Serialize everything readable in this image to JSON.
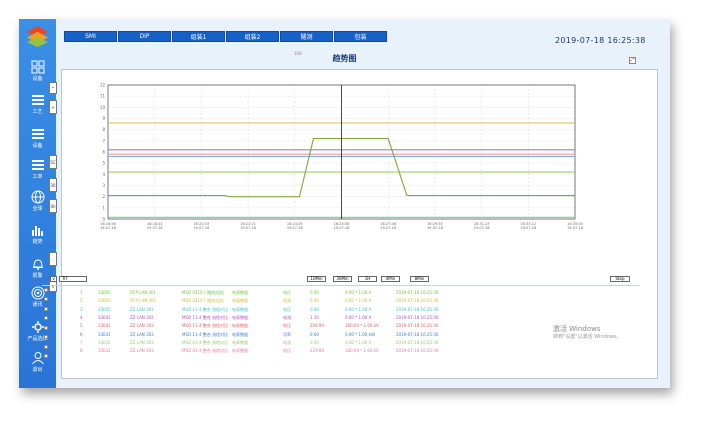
{
  "app": {
    "datetime": "2019-07-18  16:25:38",
    "page_title": "趋势图"
  },
  "tabs": [
    {
      "label": "SMI"
    },
    {
      "label": "DIP"
    },
    {
      "label": "组装1"
    },
    {
      "label": "组装2"
    },
    {
      "label": "隧测"
    },
    {
      "label": "包装"
    }
  ],
  "sidebar": {
    "items": [
      {
        "label": "设备",
        "icon": "grid-icon"
      },
      {
        "label": "工艺",
        "icon": "list-icon"
      },
      {
        "label": "设备",
        "icon": "list-icon"
      },
      {
        "label": "工单",
        "icon": "list-icon"
      },
      {
        "label": "全球",
        "icon": "globe-icon"
      },
      {
        "label": "趋势",
        "icon": "bar-chart-icon"
      },
      {
        "label": "报警",
        "icon": "bell-icon"
      },
      {
        "label": "通讯",
        "icon": "target-icon"
      },
      {
        "label": "产品选择",
        "icon": "gear-icon"
      },
      {
        "label": "退出",
        "icon": "user-icon"
      }
    ]
  },
  "chart_controls": {
    "legend_top": "100",
    "left_buttons": [
      "^",
      "+",
      "5C",
      "30",
      "Sh",
      "-",
      "v"
    ],
    "bottom_left": "v",
    "trend_label": "TrT",
    "zoom_buttons": [
      "10Min",
      "30Min",
      "1H",
      "4Min",
      "8Min"
    ],
    "stop_label": "Stop",
    "expand_label": "⤢"
  },
  "chart_data": {
    "type": "line",
    "y_ticks": [
      "12",
      "11",
      "10",
      "9",
      "8",
      "7",
      "6",
      "5",
      "4",
      "3",
      "2",
      "1",
      "0"
    ],
    "x_labels": [
      [
        "16:16:56",
        "19-07-18"
      ],
      [
        "16:18:44",
        "19-07-18"
      ],
      [
        "16:20:33",
        "19-07-18"
      ],
      [
        "16:22:21",
        "19-07-18"
      ],
      [
        "16:24:09",
        "19-07-18"
      ],
      [
        "16:25:58",
        "19-07-18"
      ],
      [
        "16:27:46",
        "19-07-18"
      ],
      [
        "16:29:35",
        "19-07-18"
      ],
      [
        "16:31:23",
        "19-07-18"
      ],
      [
        "16:33:12",
        "19-07-18"
      ],
      [
        "16:35:00",
        "19-07-18"
      ]
    ],
    "ylim": [
      0,
      12
    ],
    "cursor_x": 5,
    "grid": true,
    "series": [
      {
        "color": "#e3c35a",
        "values": [
          [
            0,
            8.6
          ],
          [
            10,
            8.6
          ]
        ]
      },
      {
        "color": "#9b7fd1",
        "values": [
          [
            0,
            6.2
          ],
          [
            10,
            6.2
          ]
        ]
      },
      {
        "color": "#e89ba0",
        "values": [
          [
            0,
            5.8
          ],
          [
            10,
            5.8
          ]
        ]
      },
      {
        "color": "#7cb4e8",
        "values": [
          [
            0,
            5.6
          ],
          [
            10,
            5.6
          ]
        ]
      },
      {
        "color": "#a3c873",
        "values": [
          [
            0,
            4.2
          ],
          [
            10,
            4.2
          ]
        ]
      },
      {
        "color": "#7ea83c",
        "values": [
          [
            0,
            2.1
          ],
          [
            2.5,
            2.1
          ],
          [
            2.6,
            2.0
          ],
          [
            4.1,
            2.0
          ],
          [
            4.4,
            7.2
          ],
          [
            6.0,
            7.2
          ],
          [
            6.4,
            2.1
          ],
          [
            10,
            2.1
          ]
        ]
      },
      {
        "color": "#6fd97a",
        "values": [
          [
            0,
            0.15
          ],
          [
            10,
            0.15
          ]
        ]
      }
    ]
  },
  "table": {
    "rows": [
      {
        "no": "1",
        "c2": "33E05",
        "c3": "OFP LAN 301",
        "c4": "MSO 0410 门槛电话机",
        "c5": "电表数据",
        "c6": "电压",
        "c7": "0.00",
        "c8": "0.00 * 1.00 A",
        "c9": "2019-07-18 16:25:36",
        "color": "#6fc83e"
      },
      {
        "no": "2",
        "c2": "33E05",
        "c3": "OFP LAN 302",
        "c4": "MSO 0410 门槛电话机",
        "c5": "电表数据",
        "c6": "电流",
        "c7": "0.00",
        "c8": "0.00 * 1.00 A",
        "c9": "2019-07-18 16:25:36",
        "color": "#d6b83a"
      },
      {
        "no": "3",
        "c2": "33E05",
        "c3": "ZZ LAN 301",
        "c4": "MSO 11-4 整合 流程对比",
        "c5": "电表数据",
        "c6": "电压",
        "c7": "0.00",
        "c8": "0.00 * 1.00 A",
        "c9": "2019-07-18 16:25:36",
        "color": "#3ec4c8"
      },
      {
        "no": "4",
        "c2": "33E41",
        "c3": "ZZ LAN 302",
        "c4": "MSO 11-4 整合 流程对比",
        "c5": "电表数据",
        "c6": "电流",
        "c7": "1.10",
        "c8": "0.00 * 1.00 A",
        "c9": "2019-07-18 16:25:36",
        "color": "#b04cc8"
      },
      {
        "no": "5",
        "c2": "33E41",
        "c3": "ZZ LAN 303",
        "c4": "MSO 11-4 整合 流程对比",
        "c5": "电表数据",
        "c6": "电压",
        "c7": "228.90",
        "c8": "180.00 * 1.00 kV",
        "c9": "2019-07-18 16:25:36",
        "color": "#e85c5c"
      },
      {
        "no": "6",
        "c2": "33E41",
        "c3": "ZZ LAN 303",
        "c4": "MSO 11-4 整合 流程对比",
        "c5": "电表数据",
        "c6": "功率",
        "c7": "0.00",
        "c8": "0.00 * 1.00 kW",
        "c9": "2019-07-18 16:25:36",
        "color": "#3a7cd6"
      },
      {
        "no": "7",
        "c2": "33E41",
        "c3": "ZZ LAN 303",
        "c4": "MSO 01-4 整合 流程对比",
        "c5": "电表数据",
        "c6": "电流",
        "c7": "0.00",
        "c8": "0.00 * 1.00 A",
        "c9": "2019-07-18 16:25:36",
        "color": "#9ac86e"
      },
      {
        "no": "8",
        "c2": "33E41",
        "c3": "ZZ LAN 303",
        "c4": "MSO 01-4 整合 流程对比",
        "c5": "电表数据",
        "c6": "电压",
        "c7": "229.80",
        "c8": "180.00 * 1.00 kV",
        "c9": "2019-07-18 16:25:36",
        "color": "#e87c9c"
      }
    ]
  },
  "watermark": {
    "line1": "激活 Windows",
    "line2": "转到\"设置\"以激活 Windows。"
  }
}
